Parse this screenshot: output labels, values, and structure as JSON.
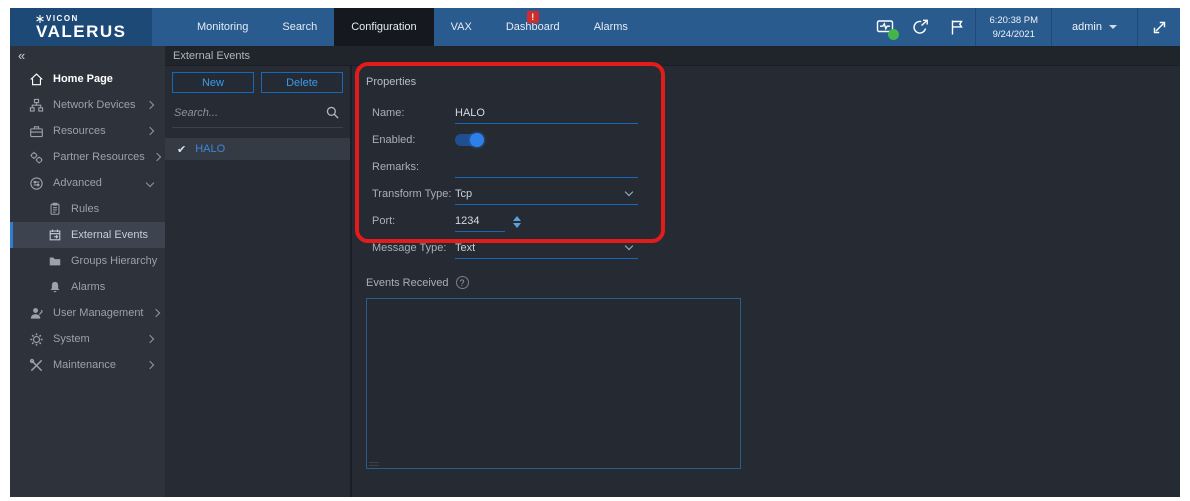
{
  "topbar": {
    "brand": {
      "vicon": "VICON",
      "valerus": "VALERUS"
    },
    "menu": [
      {
        "label": "Monitoring"
      },
      {
        "label": "Search"
      },
      {
        "label": "Configuration",
        "active": true
      },
      {
        "label": "VAX"
      },
      {
        "label": "Dashboard",
        "alert_badge": "!"
      },
      {
        "label": "Alarms"
      }
    ],
    "clock": {
      "time": "6:20:38 PM",
      "date": "9/24/2021"
    },
    "user_menu": {
      "label": "admin"
    }
  },
  "sidebar": {
    "collapse_icon": "«",
    "items": [
      {
        "label": "Home Page",
        "icon": "home-icon"
      },
      {
        "label": "Network Devices",
        "icon": "network-devices-icon",
        "expandable": true
      },
      {
        "label": "Resources",
        "icon": "resources-icon",
        "expandable": true
      },
      {
        "label": "Partner Resources",
        "icon": "partner-resources-icon",
        "expandable": true
      },
      {
        "label": "Advanced",
        "icon": "advanced-icon",
        "expanded": true
      },
      {
        "label": "Rules",
        "icon": "rules-icon",
        "sub": true
      },
      {
        "label": "External Events",
        "icon": "external-events-icon",
        "sub": true,
        "selected": true
      },
      {
        "label": "Groups Hierarchy",
        "icon": "groups-hierarchy-icon",
        "sub": true
      },
      {
        "label": "Alarms",
        "icon": "alarms-icon",
        "sub": true
      },
      {
        "label": "User Management",
        "icon": "user-management-icon",
        "expandable": true
      },
      {
        "label": "System",
        "icon": "system-icon",
        "expandable": true
      },
      {
        "label": "Maintenance",
        "icon": "maintenance-icon",
        "expandable": true
      }
    ]
  },
  "content": {
    "page_title": "External Events",
    "list_panel": {
      "new_button": "New",
      "delete_button": "Delete",
      "search_placeholder": "Search...",
      "items": [
        {
          "name": "HALO",
          "selected": true,
          "check": "✔"
        }
      ]
    },
    "properties": {
      "title": "Properties",
      "name_label": "Name:",
      "name_value": "HALO",
      "enabled_label": "Enabled:",
      "enabled_state": "on",
      "remarks_label": "Remarks:",
      "remarks_value": "",
      "transform_label": "Transform Type:",
      "transform_value": "Tcp",
      "port_label": "Port:",
      "port_value": "1234",
      "message_label": "Message Type:",
      "message_value": "Text",
      "events_received_label": "Events Received",
      "events_received_content": ""
    }
  },
  "colors": {
    "topbar_blue": "#295b8f",
    "logo_block_blue": "#1c4976",
    "accent_blue": "#2f8fe0",
    "annotation_red": "#e31b1b",
    "status_green": "#43b64a",
    "selected_row_bg": "#3d4450"
  }
}
